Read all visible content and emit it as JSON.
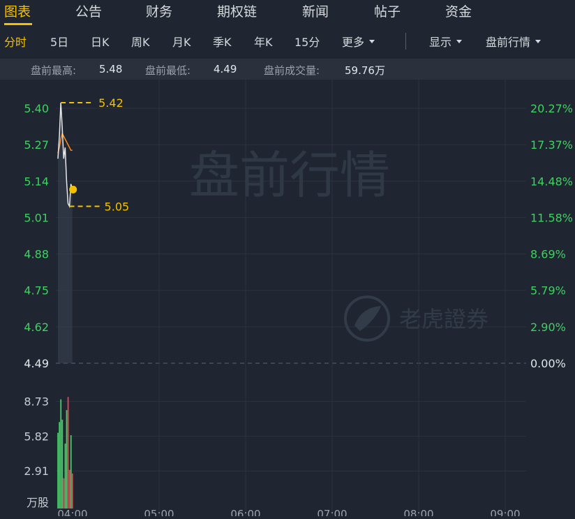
{
  "tabs": [
    {
      "label": "图表",
      "active": true
    },
    {
      "label": "公告"
    },
    {
      "label": "财务"
    },
    {
      "label": "期权链"
    },
    {
      "label": "新闻"
    },
    {
      "label": "帖子"
    },
    {
      "label": "资金"
    }
  ],
  "toolbar": {
    "periods": [
      "分时",
      "5日",
      "日K",
      "周K",
      "月K",
      "季K",
      "年K",
      "15分"
    ],
    "more_label": "更多",
    "display_label": "显示",
    "premarket_label": "盘前行情"
  },
  "premarket": {
    "high_label": "盘前最高:",
    "high_value": "5.48",
    "low_label": "盘前最低:",
    "low_value": "4.49",
    "volume_label": "盘前成交量:",
    "volume_value": "59.76万"
  },
  "watermark": {
    "text": "盘前行情",
    "brand": "老虎證券"
  },
  "colors": {
    "accent": "#f3c100",
    "up": "#3ed160",
    "down": "#e8464f",
    "avg_line": "#ff8a1e"
  },
  "chart_data": {
    "type": "line",
    "title": "",
    "xlabel": "",
    "ylabel": "",
    "y_ticks": [
      "5.40",
      "5.27",
      "5.14",
      "5.01",
      "4.88",
      "4.75",
      "4.62",
      "4.49"
    ],
    "y_tick_values": [
      5.4,
      5.27,
      5.14,
      5.01,
      4.88,
      4.75,
      4.62,
      4.49
    ],
    "pct_ticks": [
      "20.27%",
      "17.37%",
      "14.48%",
      "11.58%",
      "8.69%",
      "5.79%",
      "2.90%",
      "0.00%"
    ],
    "x_ticks": [
      "04:00",
      "05:00",
      "06:00",
      "07:00",
      "08:00",
      "09:00"
    ],
    "ylim": [
      4.49,
      5.4
    ],
    "base_price": 4.49,
    "annotations": {
      "high": "5.42",
      "low": "5.05"
    },
    "annotation_values": {
      "high": 5.42,
      "low": 5.05
    },
    "price_minutes": [
      0,
      1,
      2,
      3,
      4,
      5,
      6,
      7,
      8,
      9,
      10
    ],
    "price": [
      5.22,
      5.3,
      5.42,
      5.33,
      5.22,
      5.26,
      5.14,
      5.06,
      5.05,
      5.13,
      5.11
    ],
    "avg": [
      5.24,
      5.26,
      5.29,
      5.31,
      5.3,
      5.29,
      5.28,
      5.27,
      5.26,
      5.25,
      5.25
    ],
    "current_price": 5.11,
    "volume_ticks": [
      "8.73",
      "5.82",
      "2.91"
    ],
    "volume_tick_values": [
      8.73,
      5.82,
      2.91
    ],
    "volume_unit": "万股",
    "volume_ylim": [
      0,
      9.0
    ],
    "volume": [
      {
        "m": 0,
        "v": 6.1,
        "dir": "up"
      },
      {
        "m": 1,
        "v": 7.0,
        "dir": "up"
      },
      {
        "m": 2,
        "v": 8.9,
        "dir": "up"
      },
      {
        "m": 3,
        "v": 7.2,
        "dir": "up"
      },
      {
        "m": 4,
        "v": 2.3,
        "dir": "down"
      },
      {
        "m": 5,
        "v": 5.2,
        "dir": "up"
      },
      {
        "m": 6,
        "v": 8.0,
        "dir": "up"
      },
      {
        "m": 7,
        "v": 9.1,
        "dir": "down"
      },
      {
        "m": 8,
        "v": 3.0,
        "dir": "down"
      },
      {
        "m": 9,
        "v": 5.9,
        "dir": "up"
      },
      {
        "m": 10,
        "v": 2.7,
        "dir": "down"
      }
    ]
  }
}
